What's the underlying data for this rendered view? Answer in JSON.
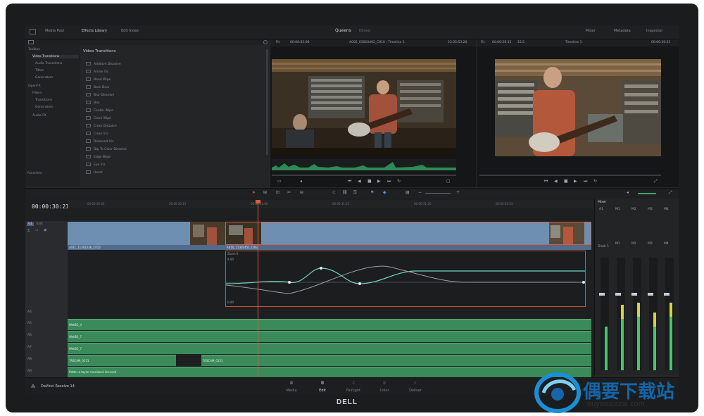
{
  "topbar": {
    "media_pool": "Media Pool",
    "effects_library": "Effects Library",
    "edit_index": "Edit Index",
    "project_name": "Queens",
    "project_status": "Edited",
    "mixer": "Mixer",
    "metadata": "Metadata",
    "inspector": "Inspector"
  },
  "library": {
    "tree": [
      "Toolbox",
      "Video Transitions",
      "Audio Transitions",
      "Titles",
      "Generators",
      "OpenFX",
      "Filters",
      "Transitions",
      "Generators",
      "Audio FX"
    ],
    "favorites": "Favorites",
    "section_title": "Video Transitions",
    "transitions": [
      "Additive Dissolve",
      "Arrow Iris",
      "Band Wipe",
      "Barn Door",
      "Blur Dissolve",
      "Box",
      "Center Wipe",
      "Clock Wipe",
      "Cross Dissolve",
      "Cross Iris",
      "Diamond Iris",
      "Dip To Color Dissolve",
      "Edge Wipe",
      "Eye Iris",
      "Heart"
    ]
  },
  "source_viewer": {
    "fit": "Fit",
    "timecode": "00:00:02:08",
    "clip_name": "A002_03010402_C010 - Timeline 1",
    "duration": "23:35:53:20"
  },
  "timeline_viewer": {
    "fit": "Fit",
    "timecode": "00:00:26:13",
    "zoom": "15.5",
    "name": "Timeline 1",
    "end_timecode": "00:00:30:21"
  },
  "timeline": {
    "current_timecode": "00:00:30:21",
    "ruler": [
      "00:00:30:00",
      "00:00:30:15",
      "00:00:31:00",
      "00:00:31:15",
      "00:00:31:20",
      "00:00:32:03"
    ],
    "video_track": "V1",
    "video_track_name": "Edit",
    "video_clips": [
      "a011_11301236_C012",
      "A010_11301451_C062"
    ],
    "effect_label": "Zoom X",
    "curve_top_val": "4.00",
    "curve_bottom_val": "0.00",
    "audio_tracks": [
      "A4",
      "A5",
      "A6",
      "A7",
      "A8",
      "A9"
    ],
    "audio_clips": [
      "WetBG_4",
      "WetBG_7",
      "WetBG_7",
      "TASCAM_0151",
      "TASCAM_0151",
      "flatter a taylor musicbed licensed"
    ]
  },
  "mixer": {
    "title": "Mixer",
    "channels": [
      "A1",
      "M1",
      "M2",
      "M3",
      "M4"
    ],
    "track_label": "Track 1",
    "levels": [
      0.55,
      0.65,
      0.68,
      0.55,
      0.68
    ]
  },
  "pages": [
    "Media",
    "Edit",
    "Fairlight",
    "Color",
    "Deliver"
  ],
  "brand": "DaVinci Resolve 14",
  "monitor_brand": "DELL",
  "watermark": {
    "title": "偶要下载站",
    "url": "ouyaoxiazai.com"
  },
  "colors": {
    "video_clip": "#6e8fb2",
    "audio_clip": "#3a8a5a",
    "playhead": "#e05a3a",
    "accent": "#d8d23a"
  }
}
